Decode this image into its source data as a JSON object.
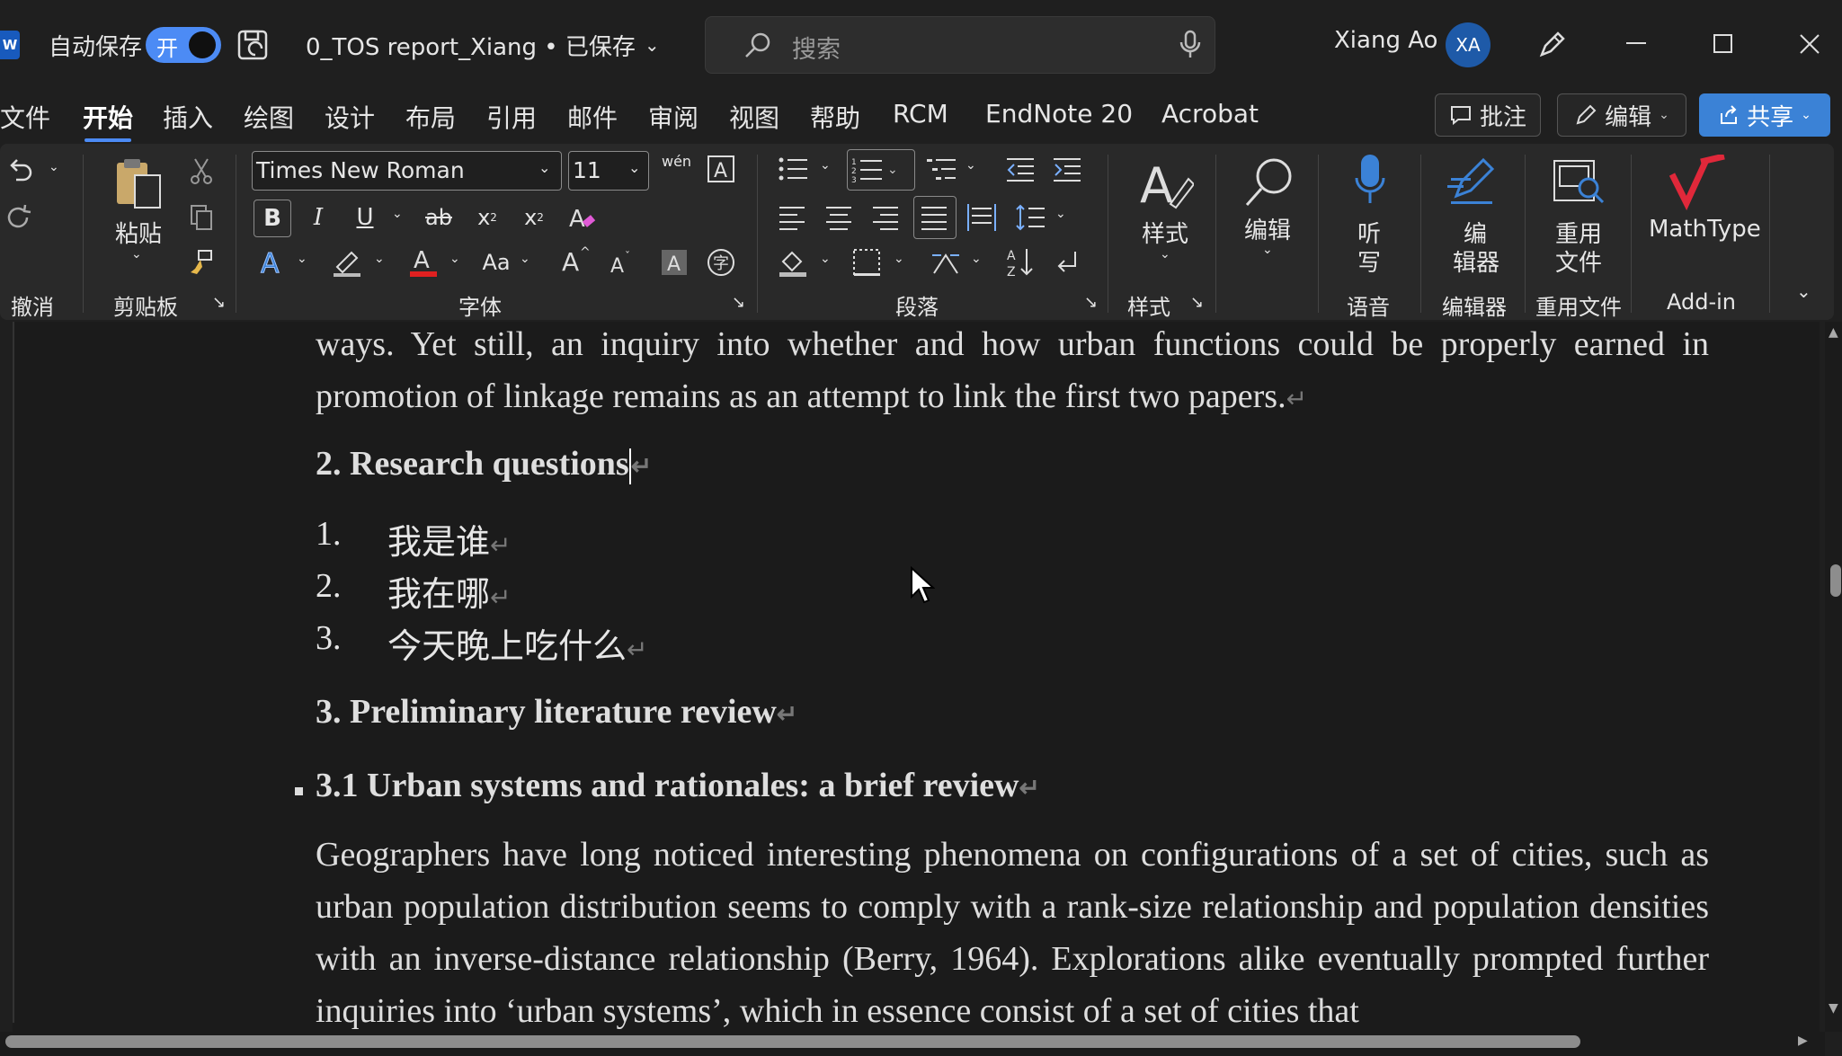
{
  "titlebar": {
    "app_icon": "W",
    "autosave_label": "自动保存",
    "autosave_toggle": "开",
    "doc_title": "0_TOS report_Xiang • 已保存",
    "search_placeholder": "搜索",
    "user_name": "Xiang Ao",
    "avatar_initials": "XA"
  },
  "tabs": [
    "文件",
    "开始",
    "插入",
    "绘图",
    "设计",
    "布局",
    "引用",
    "邮件",
    "审阅",
    "视图",
    "帮助",
    "RCM",
    "EndNote 20",
    "Acrobat"
  ],
  "active_tab": "开始",
  "actions": {
    "comments": "批注",
    "editing": "编辑",
    "share": "共享"
  },
  "ribbon": {
    "undo_group": "撤消",
    "paste": "粘贴",
    "clipboard_group": "剪贴板",
    "font_name": "Times New Roman",
    "font_size": "11",
    "font_group": "字体",
    "paragraph_group": "段落",
    "styles_button": "样式",
    "styles_group": "样式",
    "editing_button": "编辑",
    "dictate_button_1": "听",
    "dictate_button_2": "写",
    "voice_group": "语音",
    "editor_button_1": "编",
    "editor_button_2": "辑器",
    "editor_group": "编辑器",
    "reuse_button_1": "重用",
    "reuse_button_2": "文件",
    "reuse_group": "重用文件",
    "mathtype_button": "MathType",
    "addin_group": "Add-in",
    "bold": "B",
    "italic": "I",
    "underline": "U",
    "strike": "ab",
    "subscript": "x",
    "superscript": "x",
    "pinyin": "wén"
  },
  "document": {
    "para_top": "ways. Yet still, an inquiry into whether and how urban functions could be properly earned in promotion of linkage remains as an attempt to link the first two papers.",
    "heading_2": "2. Research questions",
    "list": [
      {
        "num": "1.",
        "text": "我是谁"
      },
      {
        "num": "2.",
        "text": "我在哪"
      },
      {
        "num": "3.",
        "text": "今天晚上吃什么"
      }
    ],
    "heading_3": "3. Preliminary literature review",
    "heading_31": "3.1 Urban systems and rationales: a brief review",
    "para_bottom": "Geographers have long noticed interesting phenomena on configurations of a set of cities, such as urban population distribution seems to comply with a rank-size relationship and population densities with an inverse-distance relationship (Berry, 1964). Explorations alike eventually prompted further inquiries into ‘urban systems’, which in essence consist of a set of cities that"
  }
}
